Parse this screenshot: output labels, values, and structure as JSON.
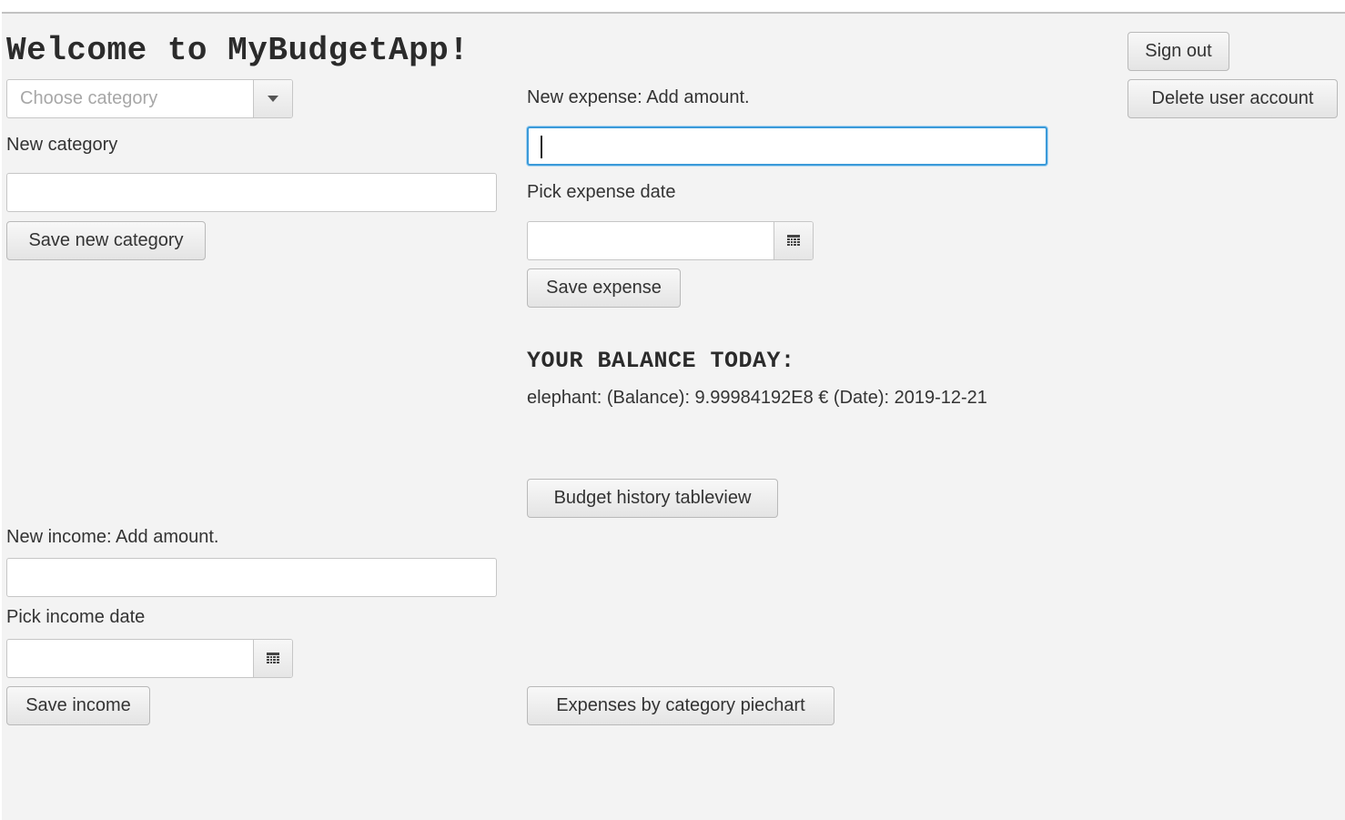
{
  "header": {
    "title": "Welcome to MyBudgetApp!",
    "sign_out_label": "Sign out",
    "delete_account_label": "Delete user account"
  },
  "category": {
    "choose_placeholder": "Choose category",
    "new_label": "New category",
    "new_value": "",
    "save_label": "Save new category"
  },
  "expense": {
    "amount_label": "New expense: Add amount.",
    "amount_value": "",
    "date_label": "Pick expense date",
    "date_value": "",
    "save_label": "Save expense"
  },
  "balance": {
    "title": "YOUR BALANCE TODAY:",
    "text": "elephant: (Balance): 9.99984192E8 € (Date): 2019-12-21"
  },
  "budget_history_label": "Budget history tableview",
  "income": {
    "amount_label": "New income: Add amount.",
    "amount_value": "",
    "date_label": "Pick income date",
    "date_value": "",
    "save_label": "Save income"
  },
  "piechart_label": "Expenses by category piechart",
  "icons": {
    "dropdown": "chevron-down-icon",
    "calendar": "calendar-icon"
  },
  "colors": {
    "background": "#f3f3f3",
    "focus_border": "#3b9ad9"
  }
}
